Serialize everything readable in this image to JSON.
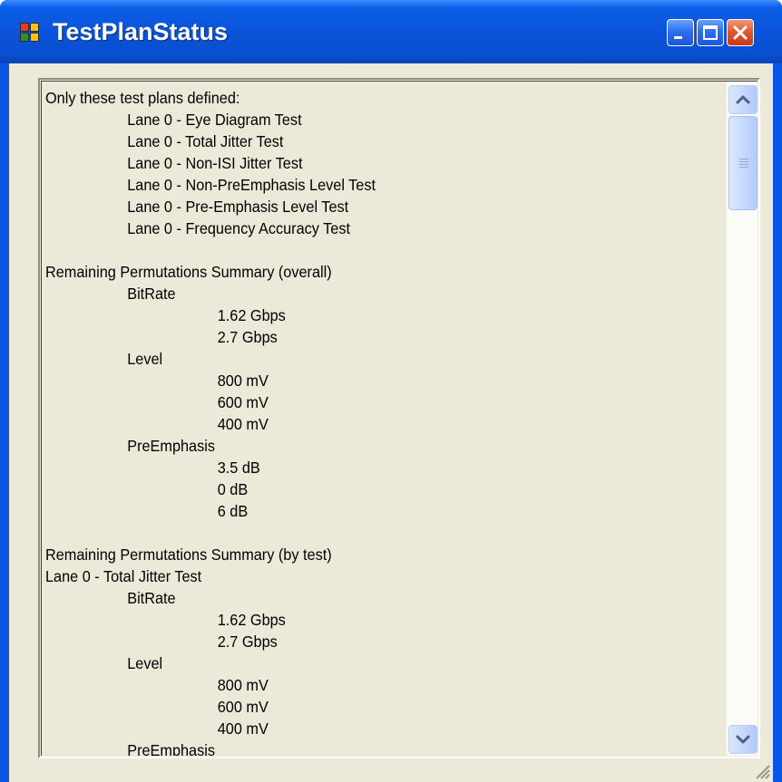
{
  "window": {
    "title": "TestPlanStatus"
  },
  "colors": {
    "title_bar": "#0a52d8",
    "frame_body": "#ece9d8",
    "close_button": "#e15a32",
    "scroll_button": "#c3d5fd"
  },
  "icons": {
    "app": "application-icon",
    "minimize": "minimize-icon",
    "maximize": "maximize-icon",
    "close": "close-icon",
    "scroll_up": "chevron-up-icon",
    "scroll_down": "chevron-down-icon",
    "resize": "resize-grip-icon"
  },
  "status_text": {
    "lines": [
      {
        "indent": 0,
        "text": "Only these test plans defined:"
      },
      {
        "indent": 1,
        "text": "Lane 0 - Eye Diagram Test"
      },
      {
        "indent": 1,
        "text": "Lane 0 - Total Jitter Test"
      },
      {
        "indent": 1,
        "text": "Lane 0 - Non-ISI Jitter Test"
      },
      {
        "indent": 1,
        "text": "Lane 0 - Non-PreEmphasis Level Test"
      },
      {
        "indent": 1,
        "text": "Lane 0 - Pre-Emphasis Level Test"
      },
      {
        "indent": 1,
        "text": "Lane 0 - Frequency Accuracy Test"
      },
      {
        "indent": 0,
        "text": ""
      },
      {
        "indent": 0,
        "text": "Remaining Permutations Summary (overall)"
      },
      {
        "indent": 1,
        "text": "BitRate"
      },
      {
        "indent": 2,
        "text": "1.62 Gbps"
      },
      {
        "indent": 2,
        "text": "2.7 Gbps"
      },
      {
        "indent": 1,
        "text": "Level"
      },
      {
        "indent": 2,
        "text": "800 mV"
      },
      {
        "indent": 2,
        "text": "600 mV"
      },
      {
        "indent": 2,
        "text": "400 mV"
      },
      {
        "indent": 1,
        "text": "PreEmphasis"
      },
      {
        "indent": 2,
        "text": "3.5 dB"
      },
      {
        "indent": 2,
        "text": "0 dB"
      },
      {
        "indent": 2,
        "text": "6 dB"
      },
      {
        "indent": 0,
        "text": ""
      },
      {
        "indent": 0,
        "text": "Remaining Permutations Summary (by test)"
      },
      {
        "indent": 0,
        "text": "Lane 0 - Total Jitter Test"
      },
      {
        "indent": 1,
        "text": "BitRate"
      },
      {
        "indent": 2,
        "text": "1.62 Gbps"
      },
      {
        "indent": 2,
        "text": "2.7 Gbps"
      },
      {
        "indent": 1,
        "text": "Level"
      },
      {
        "indent": 2,
        "text": "800 mV"
      },
      {
        "indent": 2,
        "text": "600 mV"
      },
      {
        "indent": 2,
        "text": "400 mV"
      },
      {
        "indent": 1,
        "text": "PreEmphasis"
      }
    ]
  }
}
